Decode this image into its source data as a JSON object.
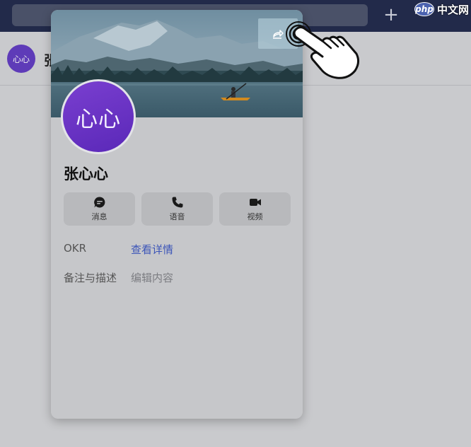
{
  "window": {
    "new_tab_label": "+",
    "watermark": {
      "badge": "php",
      "text": "中文网"
    }
  },
  "chat": {
    "avatar_text": "心心",
    "name": "张"
  },
  "profile": {
    "avatar_text": "心心",
    "name": "张心心",
    "actions": [
      {
        "label": "消息",
        "icon": "message-icon"
      },
      {
        "label": "语音",
        "icon": "phone-icon"
      },
      {
        "label": "视频",
        "icon": "video-icon"
      }
    ],
    "fields": {
      "okr": {
        "key": "OKR",
        "value": "查看详情"
      },
      "note": {
        "key": "备注与描述",
        "value": "编辑内容"
      }
    }
  },
  "colors": {
    "topbar": "#222a4a",
    "avatar": "#6a33c4",
    "link": "#3c55b8"
  }
}
